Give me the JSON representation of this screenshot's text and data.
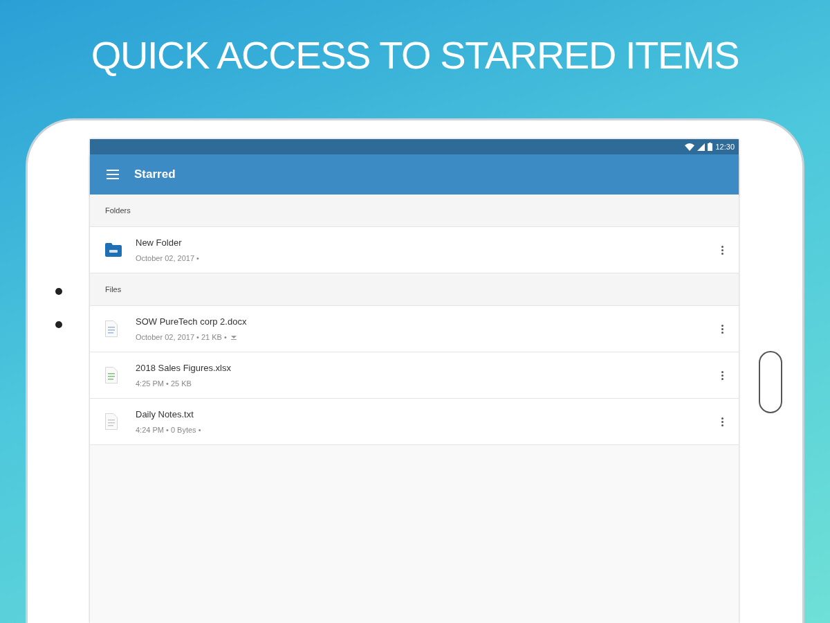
{
  "headline": "QUICK ACCESS TO STARRED ITEMS",
  "status_bar": {
    "time": "12:30"
  },
  "app_bar": {
    "title": "Starred"
  },
  "sections": [
    {
      "title": "Folders",
      "items": [
        {
          "kind": "folder",
          "name": "New Folder",
          "meta": "October 02, 2017 •",
          "offline": false
        }
      ]
    },
    {
      "title": "Files",
      "items": [
        {
          "kind": "doc",
          "name": "SOW PureTech corp 2.docx",
          "meta": "October 02, 2017 • 21 KB •",
          "offline": true
        },
        {
          "kind": "sheet",
          "name": "2018 Sales Figures.xlsx",
          "meta": "4:25 PM • 25 KB",
          "offline": false
        },
        {
          "kind": "text",
          "name": "Daily Notes.txt",
          "meta": "4:24 PM • 0 Bytes •",
          "offline": false
        }
      ]
    }
  ]
}
